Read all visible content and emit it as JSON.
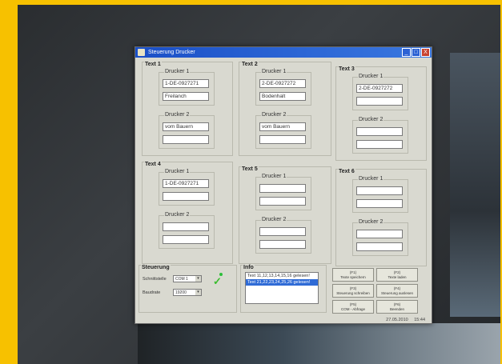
{
  "window": {
    "title": "Steuerung Drucker",
    "close_label": "X",
    "min_label": "_",
    "max_label": "□"
  },
  "groups": [
    {
      "title": "Text 1",
      "d1_label": "Drucker 1",
      "d1_values": [
        "1-DE-0927271",
        "Freilanch"
      ],
      "d2_label": "Drucker 2",
      "d2_values": [
        "vom Bauern",
        ""
      ]
    },
    {
      "title": "Text 2",
      "d1_label": "Drucker 1",
      "d1_values": [
        "2-DE-0927272",
        "Bodenhalt"
      ],
      "d2_label": "Drucker 2",
      "d2_values": [
        "vom Bauern",
        ""
      ]
    },
    {
      "title": "Text 3",
      "d1_label": "Drucker 1",
      "d1_values": [
        "2-DE-0927272",
        ""
      ],
      "d2_label": "Drucker 2",
      "d2_values": [
        "",
        ""
      ]
    },
    {
      "title": "Text 4",
      "d1_label": "Drucker 1",
      "d1_values": [
        "1-DE-0927271",
        ""
      ],
      "d2_label": "Drucker 2",
      "d2_values": [
        "",
        ""
      ]
    },
    {
      "title": "Text 5",
      "d1_label": "Drucker 1",
      "d1_values": [
        "",
        ""
      ],
      "d2_label": "Drucker 2",
      "d2_values": [
        "",
        ""
      ]
    },
    {
      "title": "Text 6",
      "d1_label": "Drucker 1",
      "d1_values": [
        "",
        ""
      ],
      "d2_label": "Drucker 2",
      "d2_values": [
        "",
        ""
      ]
    }
  ],
  "steuerung": {
    "title": "Steuerung",
    "port_label": "Schnittstelle",
    "port_value": "COM 1",
    "baud_label": "Baudrate",
    "baud_value": "19200"
  },
  "info": {
    "title": "Info",
    "lines": [
      "Text 11,12,13,14,15,16 gelesen!",
      "Text 21,22,23,24,25,26 gelesen!"
    ]
  },
  "buttons": [
    {
      "key": "(F1)",
      "label": "Texte speichern"
    },
    {
      "key": "(F2)",
      "label": "Texte laden"
    },
    {
      "key": "(F3)",
      "label": "Steuerung schreiben"
    },
    {
      "key": "(F4)",
      "label": "Steuerung auslesen"
    },
    {
      "key": "(F5)",
      "label": "COM - Abfrage"
    },
    {
      "key": "(F6)",
      "label": "Beenden"
    }
  ],
  "status": {
    "date": "27.05.2010",
    "time": "15:44"
  },
  "colors": {
    "titlebar": "#1a4fc7",
    "selection": "#2f6bd6",
    "ok_check": "#3bbd2e"
  }
}
